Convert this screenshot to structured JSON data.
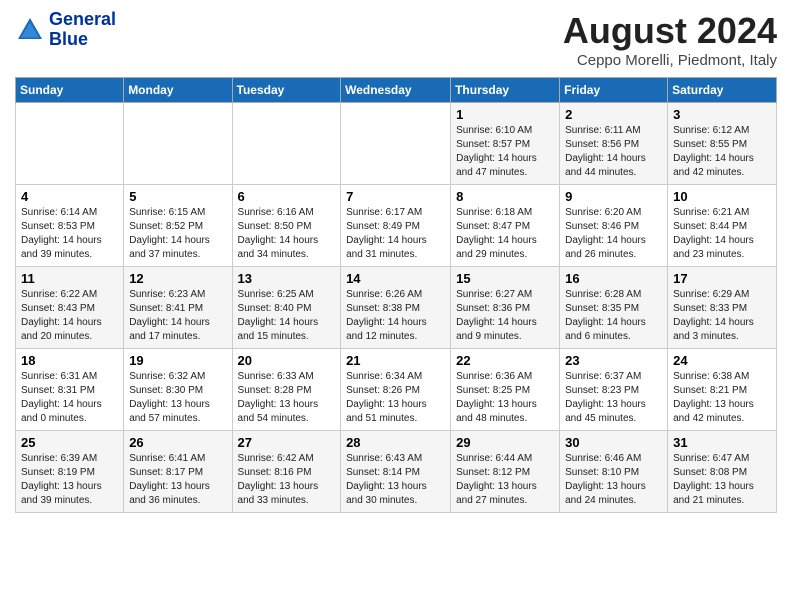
{
  "logo": {
    "line1": "General",
    "line2": "Blue"
  },
  "title": "August 2024",
  "subtitle": "Ceppo Morelli, Piedmont, Italy",
  "days_of_week": [
    "Sunday",
    "Monday",
    "Tuesday",
    "Wednesday",
    "Thursday",
    "Friday",
    "Saturday"
  ],
  "weeks": [
    [
      {
        "day": "",
        "info": ""
      },
      {
        "day": "",
        "info": ""
      },
      {
        "day": "",
        "info": ""
      },
      {
        "day": "",
        "info": ""
      },
      {
        "day": "1",
        "info": "Sunrise: 6:10 AM\nSunset: 8:57 PM\nDaylight: 14 hours\nand 47 minutes."
      },
      {
        "day": "2",
        "info": "Sunrise: 6:11 AM\nSunset: 8:56 PM\nDaylight: 14 hours\nand 44 minutes."
      },
      {
        "day": "3",
        "info": "Sunrise: 6:12 AM\nSunset: 8:55 PM\nDaylight: 14 hours\nand 42 minutes."
      }
    ],
    [
      {
        "day": "4",
        "info": "Sunrise: 6:14 AM\nSunset: 8:53 PM\nDaylight: 14 hours\nand 39 minutes."
      },
      {
        "day": "5",
        "info": "Sunrise: 6:15 AM\nSunset: 8:52 PM\nDaylight: 14 hours\nand 37 minutes."
      },
      {
        "day": "6",
        "info": "Sunrise: 6:16 AM\nSunset: 8:50 PM\nDaylight: 14 hours\nand 34 minutes."
      },
      {
        "day": "7",
        "info": "Sunrise: 6:17 AM\nSunset: 8:49 PM\nDaylight: 14 hours\nand 31 minutes."
      },
      {
        "day": "8",
        "info": "Sunrise: 6:18 AM\nSunset: 8:47 PM\nDaylight: 14 hours\nand 29 minutes."
      },
      {
        "day": "9",
        "info": "Sunrise: 6:20 AM\nSunset: 8:46 PM\nDaylight: 14 hours\nand 26 minutes."
      },
      {
        "day": "10",
        "info": "Sunrise: 6:21 AM\nSunset: 8:44 PM\nDaylight: 14 hours\nand 23 minutes."
      }
    ],
    [
      {
        "day": "11",
        "info": "Sunrise: 6:22 AM\nSunset: 8:43 PM\nDaylight: 14 hours\nand 20 minutes."
      },
      {
        "day": "12",
        "info": "Sunrise: 6:23 AM\nSunset: 8:41 PM\nDaylight: 14 hours\nand 17 minutes."
      },
      {
        "day": "13",
        "info": "Sunrise: 6:25 AM\nSunset: 8:40 PM\nDaylight: 14 hours\nand 15 minutes."
      },
      {
        "day": "14",
        "info": "Sunrise: 6:26 AM\nSunset: 8:38 PM\nDaylight: 14 hours\nand 12 minutes."
      },
      {
        "day": "15",
        "info": "Sunrise: 6:27 AM\nSunset: 8:36 PM\nDaylight: 14 hours\nand 9 minutes."
      },
      {
        "day": "16",
        "info": "Sunrise: 6:28 AM\nSunset: 8:35 PM\nDaylight: 14 hours\nand 6 minutes."
      },
      {
        "day": "17",
        "info": "Sunrise: 6:29 AM\nSunset: 8:33 PM\nDaylight: 14 hours\nand 3 minutes."
      }
    ],
    [
      {
        "day": "18",
        "info": "Sunrise: 6:31 AM\nSunset: 8:31 PM\nDaylight: 14 hours\nand 0 minutes."
      },
      {
        "day": "19",
        "info": "Sunrise: 6:32 AM\nSunset: 8:30 PM\nDaylight: 13 hours\nand 57 minutes."
      },
      {
        "day": "20",
        "info": "Sunrise: 6:33 AM\nSunset: 8:28 PM\nDaylight: 13 hours\nand 54 minutes."
      },
      {
        "day": "21",
        "info": "Sunrise: 6:34 AM\nSunset: 8:26 PM\nDaylight: 13 hours\nand 51 minutes."
      },
      {
        "day": "22",
        "info": "Sunrise: 6:36 AM\nSunset: 8:25 PM\nDaylight: 13 hours\nand 48 minutes."
      },
      {
        "day": "23",
        "info": "Sunrise: 6:37 AM\nSunset: 8:23 PM\nDaylight: 13 hours\nand 45 minutes."
      },
      {
        "day": "24",
        "info": "Sunrise: 6:38 AM\nSunset: 8:21 PM\nDaylight: 13 hours\nand 42 minutes."
      }
    ],
    [
      {
        "day": "25",
        "info": "Sunrise: 6:39 AM\nSunset: 8:19 PM\nDaylight: 13 hours\nand 39 minutes."
      },
      {
        "day": "26",
        "info": "Sunrise: 6:41 AM\nSunset: 8:17 PM\nDaylight: 13 hours\nand 36 minutes."
      },
      {
        "day": "27",
        "info": "Sunrise: 6:42 AM\nSunset: 8:16 PM\nDaylight: 13 hours\nand 33 minutes."
      },
      {
        "day": "28",
        "info": "Sunrise: 6:43 AM\nSunset: 8:14 PM\nDaylight: 13 hours\nand 30 minutes."
      },
      {
        "day": "29",
        "info": "Sunrise: 6:44 AM\nSunset: 8:12 PM\nDaylight: 13 hours\nand 27 minutes."
      },
      {
        "day": "30",
        "info": "Sunrise: 6:46 AM\nSunset: 8:10 PM\nDaylight: 13 hours\nand 24 minutes."
      },
      {
        "day": "31",
        "info": "Sunrise: 6:47 AM\nSunset: 8:08 PM\nDaylight: 13 hours\nand 21 minutes."
      }
    ]
  ]
}
